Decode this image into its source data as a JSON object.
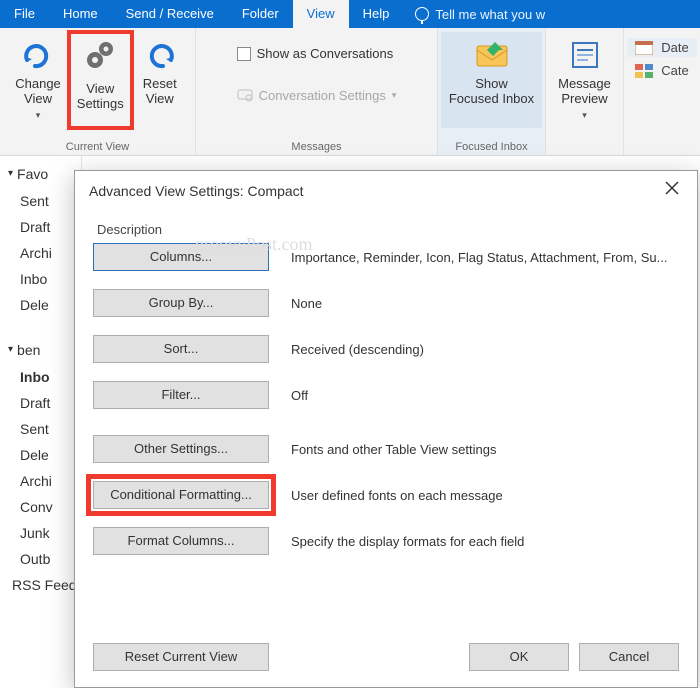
{
  "tabs": {
    "file": "File",
    "home": "Home",
    "sendreceive": "Send / Receive",
    "folder": "Folder",
    "view": "View",
    "help": "Help",
    "tell": "Tell me what you w"
  },
  "ribbon": {
    "currentView": {
      "label": "Current View",
      "change": "Change View",
      "settings": "View Settings",
      "reset": "Reset View"
    },
    "messages": {
      "label": "Messages",
      "showConversations": "Show as Conversations",
      "conversationSettings": "Conversation Settings"
    },
    "focused": {
      "label": "Focused Inbox",
      "btn": "Show Focused Inbox"
    },
    "preview": {
      "btn": "Message Preview"
    },
    "arrange": {
      "date": "Date",
      "cate": "Cate"
    }
  },
  "nav": {
    "fav": "Favo",
    "items1": [
      "Sent",
      "Draft",
      "Archi",
      "Inbo",
      "Dele"
    ],
    "acct": "ben",
    "items2": [
      "Inbo",
      "Draft",
      "Sent",
      "Dele",
      "Archi",
      "Conv",
      "Junk",
      "Outb",
      "RSS Feeds"
    ]
  },
  "dialog": {
    "title": "Advanced View Settings: Compact",
    "description": "Description",
    "watermark": "groovyPost.com",
    "rows": {
      "columns": {
        "btn": "Columns...",
        "val": "Importance, Reminder, Icon, Flag Status, Attachment, From, Su..."
      },
      "group": {
        "btn": "Group By...",
        "val": "None"
      },
      "sort": {
        "btn": "Sort...",
        "val": "Received (descending)"
      },
      "filter": {
        "btn": "Filter...",
        "val": "Off"
      },
      "other": {
        "btn": "Other Settings...",
        "val": "Fonts and other Table View settings"
      },
      "cond": {
        "btn": "Conditional Formatting...",
        "val": "User defined fonts on each message"
      },
      "format": {
        "btn": "Format Columns...",
        "val": "Specify the display formats for each field"
      }
    },
    "reset": "Reset Current View",
    "ok": "OK",
    "cancel": "Cancel"
  }
}
